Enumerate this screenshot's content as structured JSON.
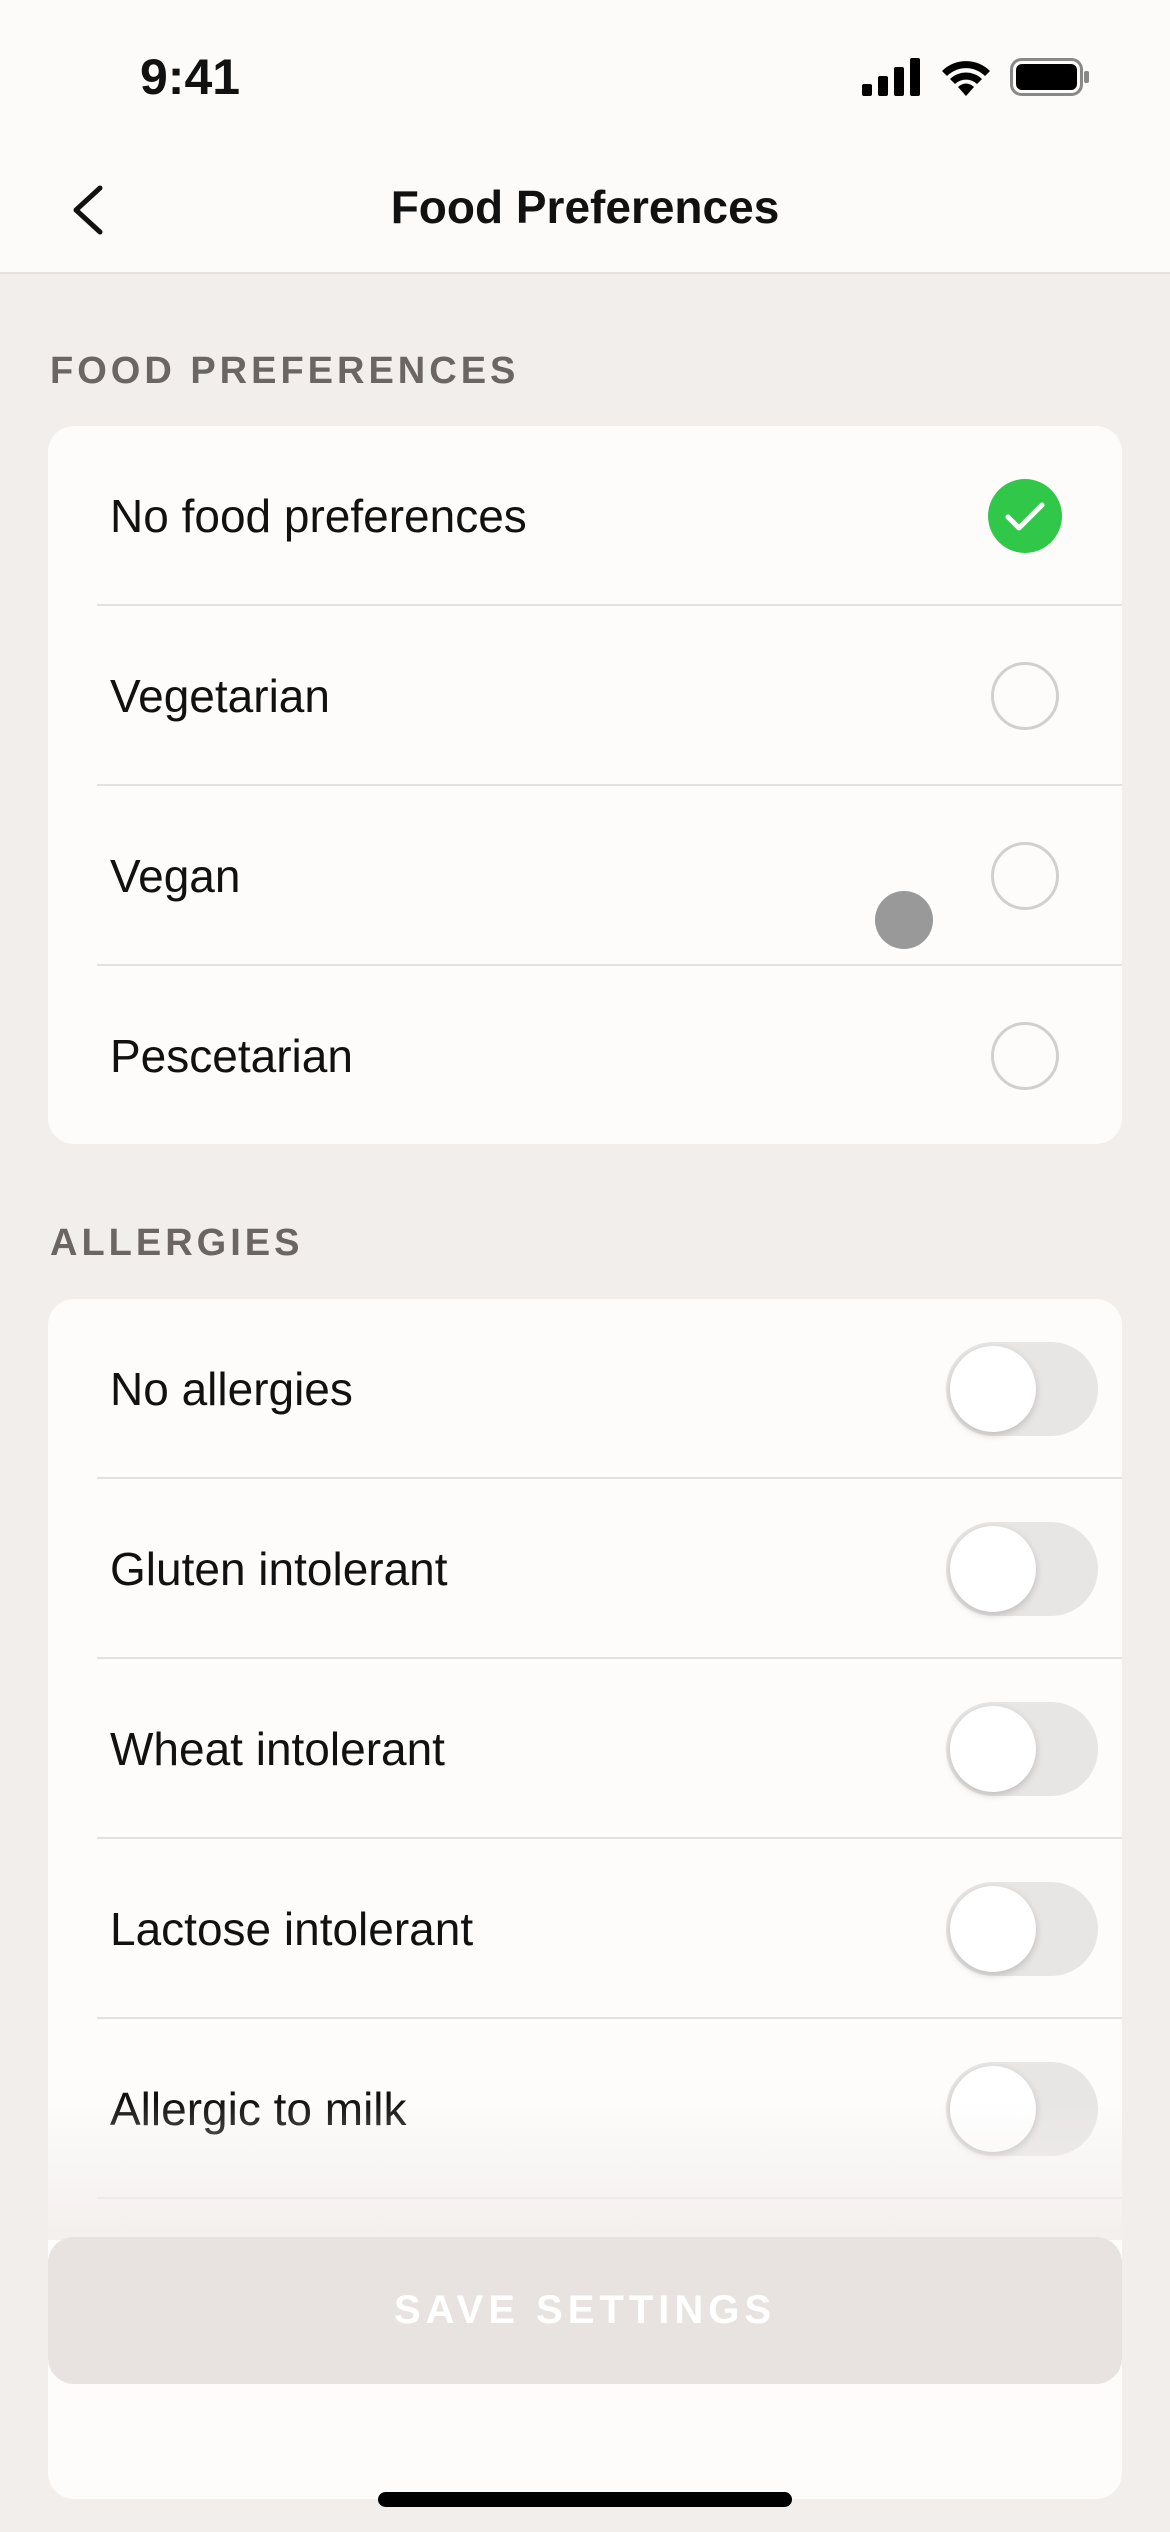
{
  "status_bar": {
    "time": "9:41"
  },
  "nav": {
    "title": "Food Preferences"
  },
  "food_preferences": {
    "header": "FOOD PREFERENCES",
    "items": [
      {
        "label": "No food preferences",
        "selected": true
      },
      {
        "label": "Vegetarian",
        "selected": false
      },
      {
        "label": "Vegan",
        "selected": false
      },
      {
        "label": "Pescetarian",
        "selected": false
      }
    ]
  },
  "allergies": {
    "header": "ALLERGIES",
    "items": [
      {
        "label": "No allergies",
        "on": false
      },
      {
        "label": "Gluten intolerant",
        "on": false
      },
      {
        "label": "Wheat intolerant",
        "on": false
      },
      {
        "label": "Lactose intolerant",
        "on": false
      },
      {
        "label": "Allergic to milk",
        "on": false
      }
    ]
  },
  "save_button": {
    "label": "SAVE SETTINGS"
  },
  "colors": {
    "accent_green": "#31c84a",
    "background": "#f2eeec"
  }
}
